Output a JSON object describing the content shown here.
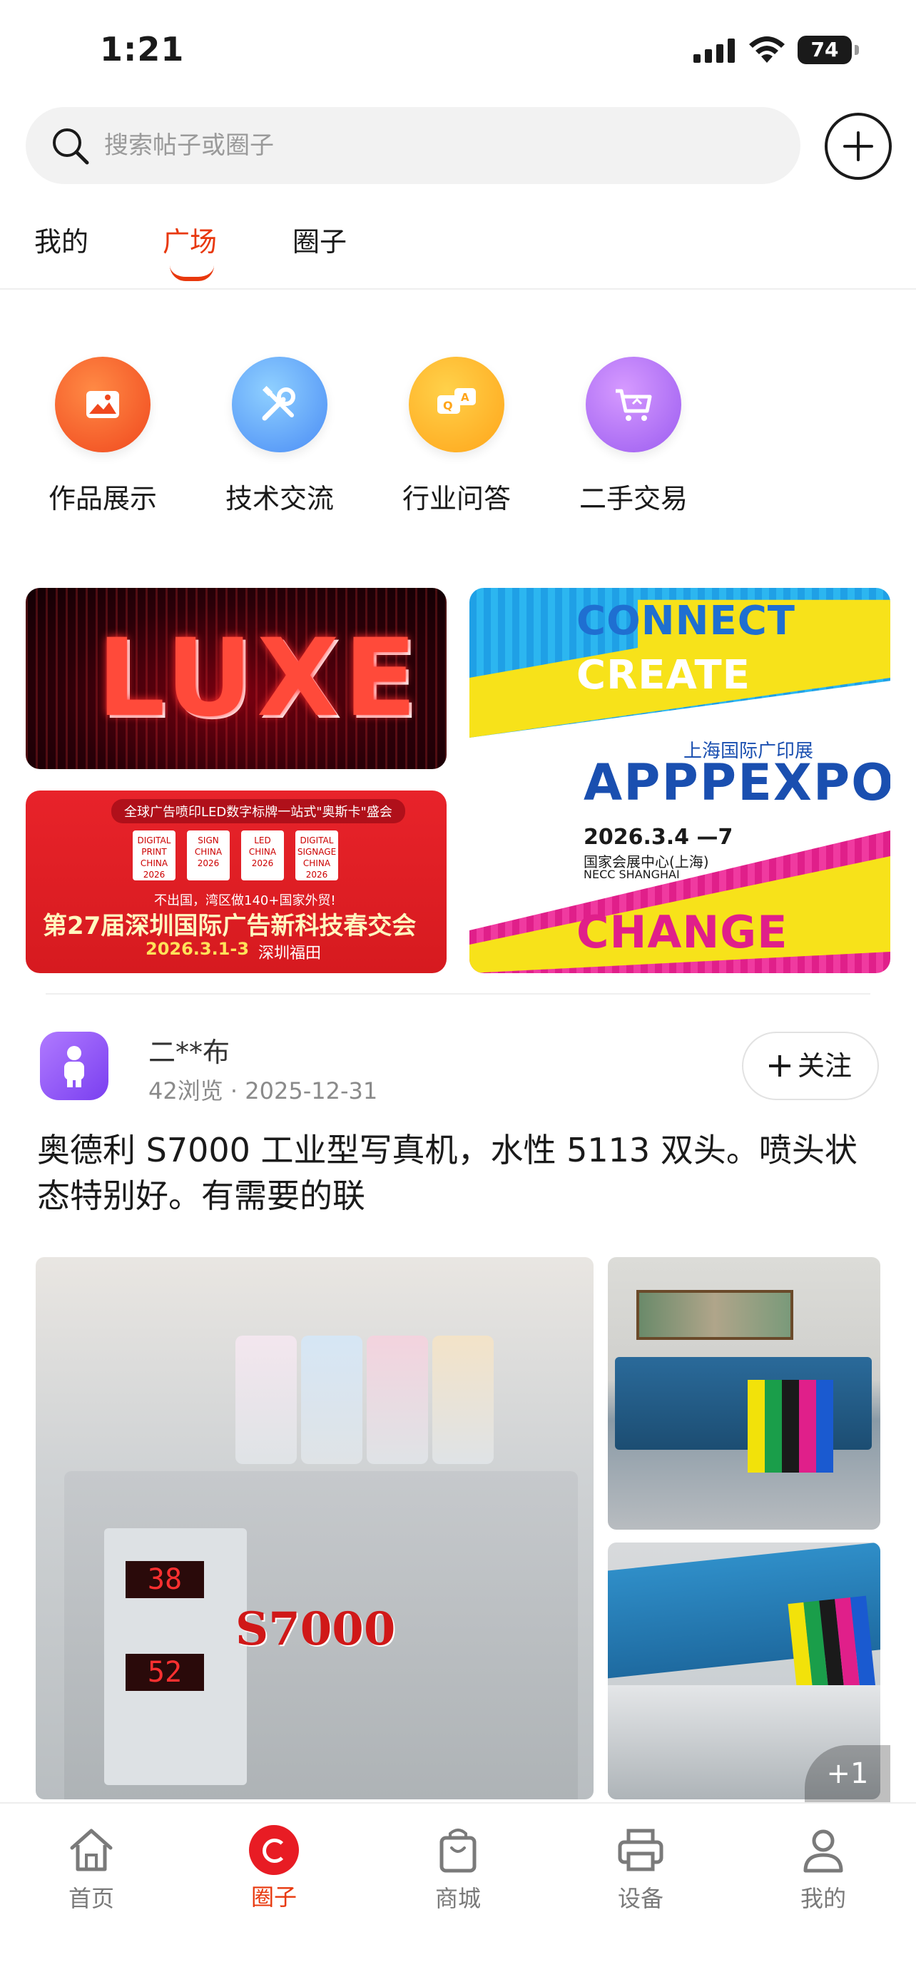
{
  "status_bar": {
    "time": "1:21",
    "battery": "74"
  },
  "search": {
    "placeholder": "搜索帖子或圈子"
  },
  "tabs": [
    {
      "label": "我的",
      "active": false
    },
    {
      "label": "广场",
      "active": true
    },
    {
      "label": "圈子",
      "active": false
    }
  ],
  "categories": [
    {
      "label": "作品展示",
      "icon": "picture-icon"
    },
    {
      "label": "技术交流",
      "icon": "tools-icon"
    },
    {
      "label": "行业问答",
      "icon": "qa-icon"
    },
    {
      "label": "二手交易",
      "icon": "cart-icon"
    }
  ],
  "banners": {
    "luxe": {
      "text": "LUXE"
    },
    "expo_cn": {
      "top": "全球广告喷印LED数字标牌一站式\"奥斯卡\"盛会",
      "logos": [
        "DIGITAL PRINT CHINA 2026",
        "SIGN CHINA 2026",
        "LED CHINA 2026",
        "DIGITAL SIGNAGE CHINA 2026"
      ],
      "sub": "不出国，湾区做140+国家外贸!",
      "title": "第27届深圳国际广告新科技春交会",
      "date": "2026.3.1-3",
      "place": "深圳福田"
    },
    "appp": {
      "connect": "CONNECT",
      "create": "CREATE",
      "cn": "上海国际广印展",
      "expo": "APPPEXPO",
      "date": "2026.3.4 —7",
      "venue": "国家会展中心(上海)",
      "venue_en": "NECC SHANGHAI",
      "change": "CHANGE"
    }
  },
  "post": {
    "author": "二**布",
    "views": "42浏览",
    "separator": "·",
    "date": "2025-12-31",
    "follow_label": "关注",
    "text": "奥德利 S7000 工业型写真机，水性 5113 双头。喷头状态特别好。有需要的联",
    "image_label": "S7000",
    "led_values": [
      "38",
      "52"
    ],
    "more_images": "+1"
  },
  "bottom_nav": [
    {
      "label": "首页",
      "icon": "home-icon",
      "active": false
    },
    {
      "label": "圈子",
      "icon": "circle-icon",
      "active": true
    },
    {
      "label": "商城",
      "icon": "shopping-bag-icon",
      "active": false
    },
    {
      "label": "设备",
      "icon": "printer-icon",
      "active": false
    },
    {
      "label": "我的",
      "icon": "user-icon",
      "active": false
    }
  ],
  "colors": {
    "accent": "#e8380d",
    "nav_active": "#e81c24"
  }
}
